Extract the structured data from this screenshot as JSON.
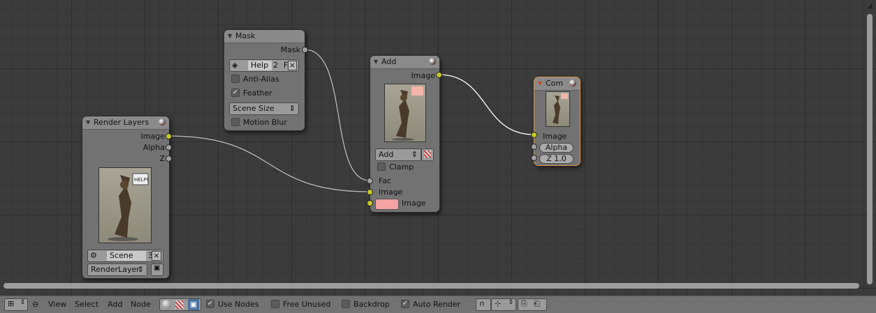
{
  "nodes": {
    "render_layers": {
      "title": "Render Layers",
      "outputs": [
        "Image",
        "Alpha",
        "Z"
      ],
      "scene_label": "Scene",
      "scene_users": "3",
      "layer_label": "RenderLayer"
    },
    "mask": {
      "title": "Mask",
      "output": "Mask",
      "mask_name": "Help",
      "mask_users": "2",
      "fake_label": "F",
      "anti_alias": "Anti-Alias",
      "feather": "Feather",
      "size_mode": "Scene Size",
      "motion_blur": "Motion Blur"
    },
    "add": {
      "title": "Add",
      "output": "Image",
      "blend_mode": "Add",
      "clamp": "Clamp",
      "inputs": [
        "Fac",
        "Image",
        "Image"
      ],
      "color_swatch": "#f4a2a2"
    },
    "composite": {
      "title": "Com",
      "input_image": "Image",
      "alpha_label": "Alpha",
      "z_label": "Z 1.0"
    }
  },
  "toolbar": {
    "menus": [
      "View",
      "Select",
      "Add",
      "Node"
    ],
    "use_nodes": "Use Nodes",
    "free_unused": "Free Unused",
    "backdrop": "Backdrop",
    "auto_render": "Auto Render",
    "thumb_help_text": "HELP!"
  },
  "colors": {
    "socket_image": "#c7c729",
    "socket_value": "#a1a1a1",
    "active_node_border": "#e0944a"
  }
}
